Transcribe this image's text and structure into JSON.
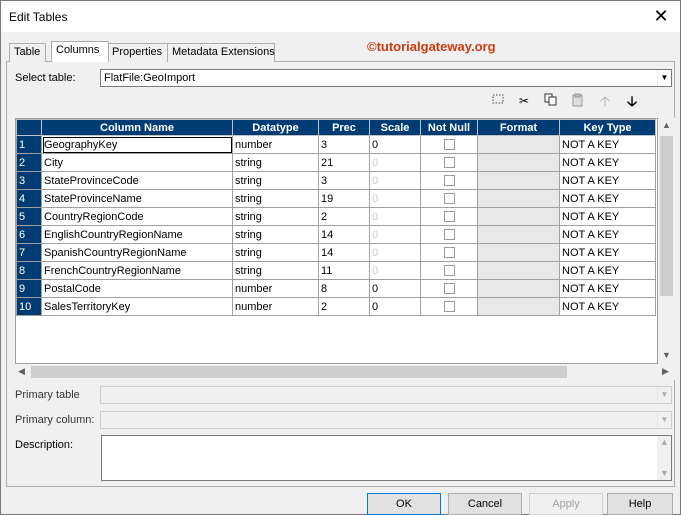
{
  "window": {
    "title": "Edit Tables"
  },
  "tabs": [
    {
      "label": "Table"
    },
    {
      "label": "Columns"
    },
    {
      "label": "Properties"
    },
    {
      "label": "Metadata Extensions"
    }
  ],
  "watermark": "©tutorialgateway.org",
  "select_table": {
    "label": "Select table:",
    "value": "FlatFile:GeoImport"
  },
  "toolbar": {
    "icons": [
      "new-column-icon",
      "cut-icon",
      "copy-icon",
      "paste-icon",
      "move-up-icon",
      "move-down-icon"
    ]
  },
  "columns_table": {
    "headers": [
      "Column Name",
      "Datatype",
      "Prec",
      "Scale",
      "Not Null",
      "Format",
      "Key Type"
    ],
    "rows": [
      {
        "num": "1",
        "name": "GeographyKey",
        "type": "number",
        "prec": "3",
        "scale": "0",
        "scale_dim": false,
        "key": "NOT A KEY"
      },
      {
        "num": "2",
        "name": "City",
        "type": "string",
        "prec": "21",
        "scale": "0",
        "scale_dim": true,
        "key": "NOT A KEY"
      },
      {
        "num": "3",
        "name": "StateProvinceCode",
        "type": "string",
        "prec": "3",
        "scale": "0",
        "scale_dim": true,
        "key": "NOT A KEY"
      },
      {
        "num": "4",
        "name": "StateProvinceName",
        "type": "string",
        "prec": "19",
        "scale": "0",
        "scale_dim": true,
        "key": "NOT A KEY"
      },
      {
        "num": "5",
        "name": "CountryRegionCode",
        "type": "string",
        "prec": "2",
        "scale": "0",
        "scale_dim": true,
        "key": "NOT A KEY"
      },
      {
        "num": "6",
        "name": "EnglishCountryRegionName",
        "type": "string",
        "prec": "14",
        "scale": "0",
        "scale_dim": true,
        "key": "NOT A KEY"
      },
      {
        "num": "7",
        "name": "SpanishCountryRegionName",
        "type": "string",
        "prec": "14",
        "scale": "0",
        "scale_dim": true,
        "key": "NOT A KEY"
      },
      {
        "num": "8",
        "name": "FrenchCountryRegionName",
        "type": "string",
        "prec": "11",
        "scale": "0",
        "scale_dim": true,
        "key": "NOT A KEY"
      },
      {
        "num": "9",
        "name": "PostalCode",
        "type": "number",
        "prec": "8",
        "scale": "0",
        "scale_dim": false,
        "key": "NOT A KEY"
      },
      {
        "num": "10",
        "name": "SalesTerritoryKey",
        "type": "number",
        "prec": "2",
        "scale": "0",
        "scale_dim": false,
        "key": "NOT A KEY"
      }
    ]
  },
  "fields": {
    "primary_table": {
      "label": "Primary table",
      "value": ""
    },
    "primary_column": {
      "label": "Primary column:",
      "value": ""
    },
    "description": {
      "label": "Description:",
      "value": ""
    }
  },
  "buttons": {
    "ok": "OK",
    "cancel": "Cancel",
    "apply": "Apply",
    "help": "Help"
  }
}
